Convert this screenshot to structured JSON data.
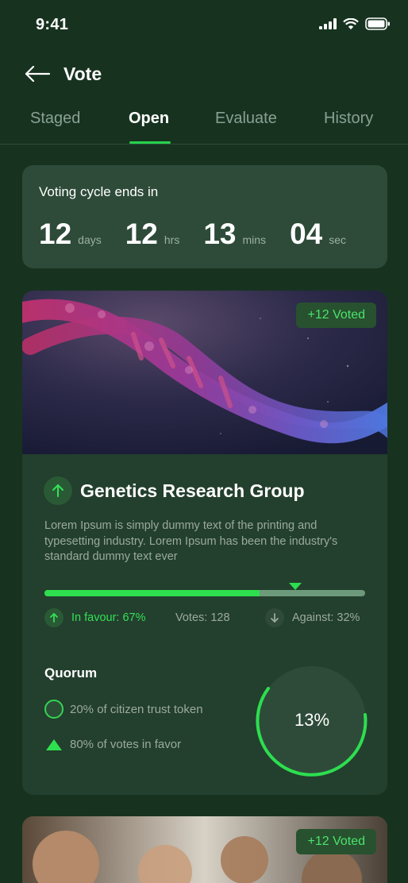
{
  "status_bar": {
    "time": "9:41"
  },
  "header": {
    "title": "Vote"
  },
  "tabs": [
    {
      "label": "Staged"
    },
    {
      "label": "Open",
      "active": true
    },
    {
      "label": "Evaluate"
    },
    {
      "label": "History"
    }
  ],
  "countdown": {
    "label": "Voting cycle ends in",
    "days_value": "12",
    "days_unit": "days",
    "hours_value": "12",
    "hours_unit": "hrs",
    "mins_value": "13",
    "mins_unit": "mins",
    "secs_value": "04",
    "secs_unit": "sec"
  },
  "proposal": {
    "voted_badge": "+12 Voted",
    "title": "Genetics Research Group",
    "description": "Lorem Ipsum is simply dummy text of the printing and typesetting industry. Lorem Ipsum has been the industry's standard dummy text ever",
    "favour_pct": 0.67,
    "in_favour": "In favour: 67%",
    "votes": "Votes: 128",
    "against": "Against: 32%",
    "quorum": {
      "title": "Quorum",
      "item1": "20% of citizen trust token",
      "item2": "80% of votes in favor",
      "percent_label": "13%"
    }
  },
  "second_card": {
    "voted_badge": "+12 Voted"
  },
  "colors": {
    "background": "#173320",
    "card": "#233f2d",
    "accent_green": "#2dde4f"
  }
}
